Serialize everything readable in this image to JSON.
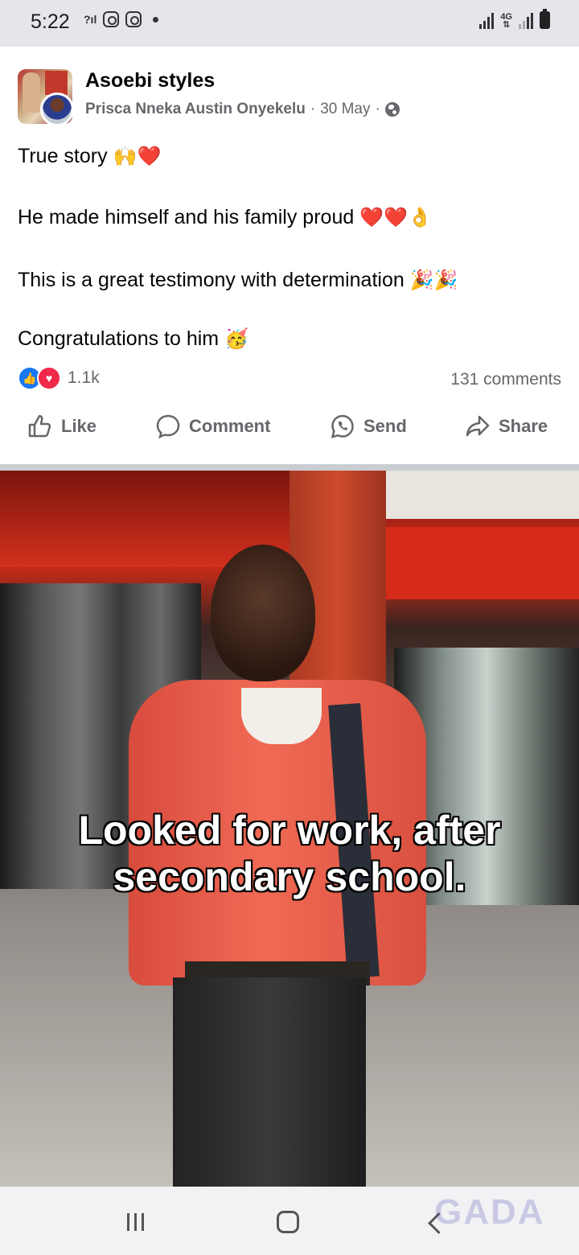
{
  "status_bar": {
    "time": "5:22",
    "left_icons": [
      "signal-question-icon",
      "instagram-icon",
      "instagram-icon",
      "notification-dot-icon"
    ],
    "right_icons": [
      "signal-bars-icon",
      "network-4g-icon",
      "signal-bars-icon",
      "battery-icon"
    ],
    "network_label": "4G"
  },
  "post": {
    "group_name": "Asoebi styles",
    "author": "Prisca Nneka Austin Onyekelu",
    "separator": "·",
    "date": "30 May",
    "privacy_icon": "globe-icon",
    "lines": [
      {
        "text": "True story",
        "emojis": "🙌❤️"
      },
      {
        "text": "He made himself and his family proud",
        "emojis": "❤️❤️👌"
      },
      {
        "text": "This is a great testimony with determination",
        "emojis": "🎉🎉"
      },
      {
        "text": "Congratulations to him",
        "emojis": "🥳"
      }
    ],
    "reaction_count": "1.1k",
    "comments_count": "131 comments",
    "actions": {
      "like": "Like",
      "comment": "Comment",
      "send": "Send",
      "share": "Share"
    }
  },
  "video": {
    "caption_line1": "Looked for work, after",
    "caption_line2": "secondary school."
  },
  "watermark": "GADA",
  "colors": {
    "facebook_blue": "#1877f2",
    "love_red": "#f0284a",
    "secondary_text": "#65676b"
  }
}
